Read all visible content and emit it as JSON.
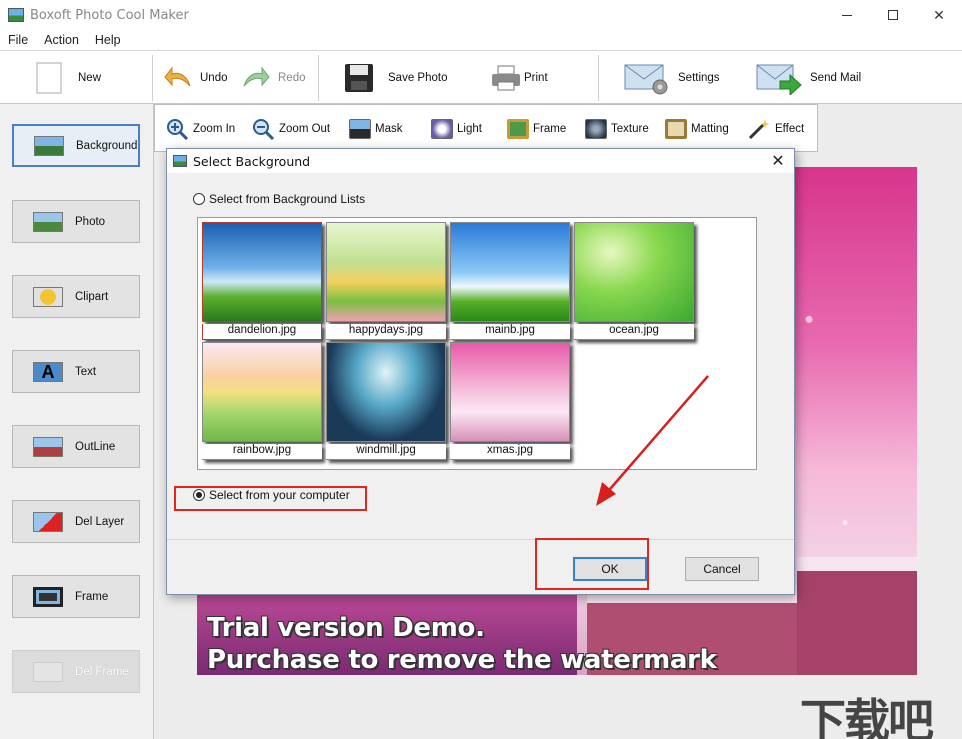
{
  "window": {
    "title": "Boxoft Photo Cool Maker",
    "minimize_icon": "minimize-icon",
    "maximize_icon": "maximize-icon",
    "close_icon": "close-icon"
  },
  "menu": {
    "file": "File",
    "action": "Action",
    "help": "Help"
  },
  "toolbar": {
    "new": "New",
    "undo": "Undo",
    "redo": "Redo",
    "save_photo": "Save Photo",
    "print": "Print",
    "settings": "Settings",
    "send_mail": "Send Mail"
  },
  "toolstrip": {
    "zoom_in": "Zoom In",
    "zoom_out": "Zoom Out",
    "mask": "Mask",
    "light": "Light",
    "frame": "Frame",
    "texture": "Texture",
    "matting": "Matting",
    "effect": "Effect"
  },
  "sidebar": {
    "items": [
      {
        "label": "Background"
      },
      {
        "label": "Photo"
      },
      {
        "label": "Clipart"
      },
      {
        "label": "Text"
      },
      {
        "label": "OutLine"
      },
      {
        "label": "Del Layer"
      },
      {
        "label": "Frame"
      },
      {
        "label": "Del Frame"
      }
    ]
  },
  "canvas": {
    "watermark_line1": "Trial version Demo.",
    "watermark_line2": "Purchase to remove the watermark"
  },
  "dialog": {
    "title": "Select Background",
    "option_lists": "Select from Background Lists",
    "option_computer": "Select from your computer",
    "thumbnails": [
      {
        "caption": "dandelion.jpg"
      },
      {
        "caption": "happydays.jpg"
      },
      {
        "caption": "mainb.jpg"
      },
      {
        "caption": "ocean.jpg"
      },
      {
        "caption": "rainbow.jpg"
      },
      {
        "caption": "windmill.jpg"
      },
      {
        "caption": "xmas.jpg"
      }
    ],
    "ok": "OK",
    "cancel": "Cancel"
  },
  "colors": {
    "highlight": "#e0261e",
    "accent": "#3c7fd0"
  }
}
